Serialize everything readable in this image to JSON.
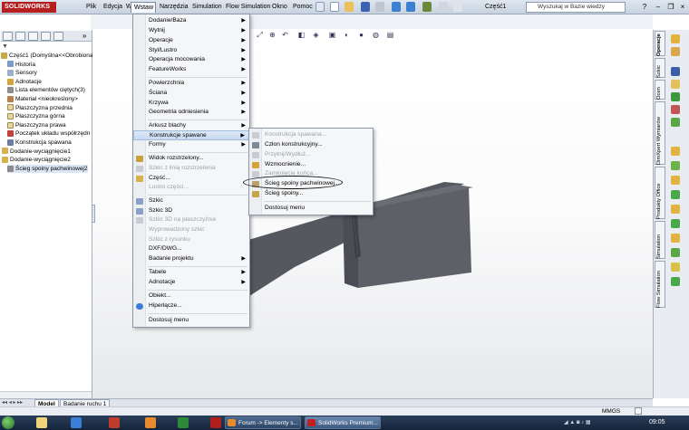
{
  "app": {
    "logo_text": "SOLIDWORKS",
    "document_title": "Część1",
    "search_placeholder": "Wyszukaj w Bazie wiedzy"
  },
  "menubar": [
    "Plik",
    "Edycja",
    "Widok",
    "Wstaw",
    "Narzędzia",
    "Simulation",
    "Flow Simulation",
    "Okno",
    "Pomoc"
  ],
  "feature_tree": {
    "items": [
      "Część1  (Domyślna<<Obrobiona>",
      "Historia",
      "Sensory",
      "Adnotacje",
      "Lista elementów ciętych(3)",
      "Materiał <nieokreślony>",
      "Płaszczyzna przednia",
      "Płaszczyzna górna",
      "Płaszczyzna prawa",
      "Początek układu współrzędn",
      "Konstrukcja spawana",
      "Dodanie-wyciągnięcie1",
      "Dodanie-wyciągnięcie2",
      "Ścieg spoiny pachwinowej2"
    ]
  },
  "insert_menu": {
    "items": [
      {
        "label": "Dodanie/Baza",
        "arrow": true
      },
      {
        "label": "Wytnij",
        "arrow": true
      },
      {
        "label": "Operacje",
        "arrow": true
      },
      {
        "label": "Styl/Lustro",
        "arrow": true
      },
      {
        "label": "Operacja mocowania",
        "arrow": true
      },
      {
        "label": "FeatureWorks",
        "arrow": true
      },
      {
        "label": "Powierzchnia",
        "arrow": true
      },
      {
        "label": "Ściana",
        "arrow": true
      },
      {
        "label": "Krzywa",
        "arrow": true
      },
      {
        "label": "Geometria odniesienia",
        "arrow": true
      },
      {
        "label": "Arkusz blachy",
        "arrow": true
      },
      {
        "label": "Konstrukcje spawane",
        "arrow": true
      },
      {
        "label": "Formy",
        "arrow": true
      },
      {
        "label": "Widok rozstrzelony...",
        "arrow": false
      },
      {
        "label": "Szkic z linią rozstrzelenia",
        "arrow": false,
        "disabled": true
      },
      {
        "label": "Część...",
        "arrow": false
      },
      {
        "label": "Lustro części...",
        "arrow": false,
        "disabled": true
      },
      {
        "label": "Szkic",
        "arrow": false
      },
      {
        "label": "Szkic 3D",
        "arrow": false
      },
      {
        "label": "Szkic 3D na płaszczyźnie",
        "arrow": false,
        "disabled": true
      },
      {
        "label": "Wyprowadzony szkic",
        "arrow": false,
        "disabled": true
      },
      {
        "label": "Szkic z rysunku",
        "arrow": false,
        "disabled": true
      },
      {
        "label": "DXF/DWG...",
        "arrow": false
      },
      {
        "label": "Badanie projektu",
        "arrow": true
      },
      {
        "label": "Tabele",
        "arrow": true
      },
      {
        "label": "Adnotacje",
        "arrow": true
      },
      {
        "label": "Obiekt...",
        "arrow": false
      },
      {
        "label": "Hiperłącze...",
        "arrow": false
      },
      {
        "label": "Dostosuj menu",
        "arrow": false
      }
    ]
  },
  "weldments_submenu": {
    "items": [
      {
        "label": "Konstrukcja spawana...",
        "disabled": true
      },
      {
        "label": "Człon konstrukcyjny...",
        "disabled": false
      },
      {
        "label": "Przytnij/Wydłuż...",
        "disabled": true
      },
      {
        "label": "Wzmocnienie...",
        "disabled": false
      },
      {
        "label": "Zamknięcie końca...",
        "disabled": true
      },
      {
        "label": "Ścieg spoiny pachwinowej...",
        "disabled": false
      },
      {
        "label": "Ścieg spoiny...",
        "disabled": false
      },
      {
        "label": "Dostosuj menu",
        "disabled": false
      }
    ]
  },
  "task_pane_tabs": [
    "Operacje",
    "Szkic",
    "Ocen",
    "DimXpert Wymiarów",
    "Produkty Office",
    "Simulation",
    "Flow Simulation"
  ],
  "bottom_tabs": [
    "Model",
    "Badanie ruchu 1"
  ],
  "status": {
    "units": "MMGS"
  },
  "taskbar": {
    "tasks": [
      "Forum -> Elementy s...",
      "SolidWorks Premium..."
    ],
    "clock": "09:05"
  },
  "colors": {
    "accent": "#b51f1f",
    "highlight": "#c7daf1",
    "model": "#5c5f66"
  }
}
